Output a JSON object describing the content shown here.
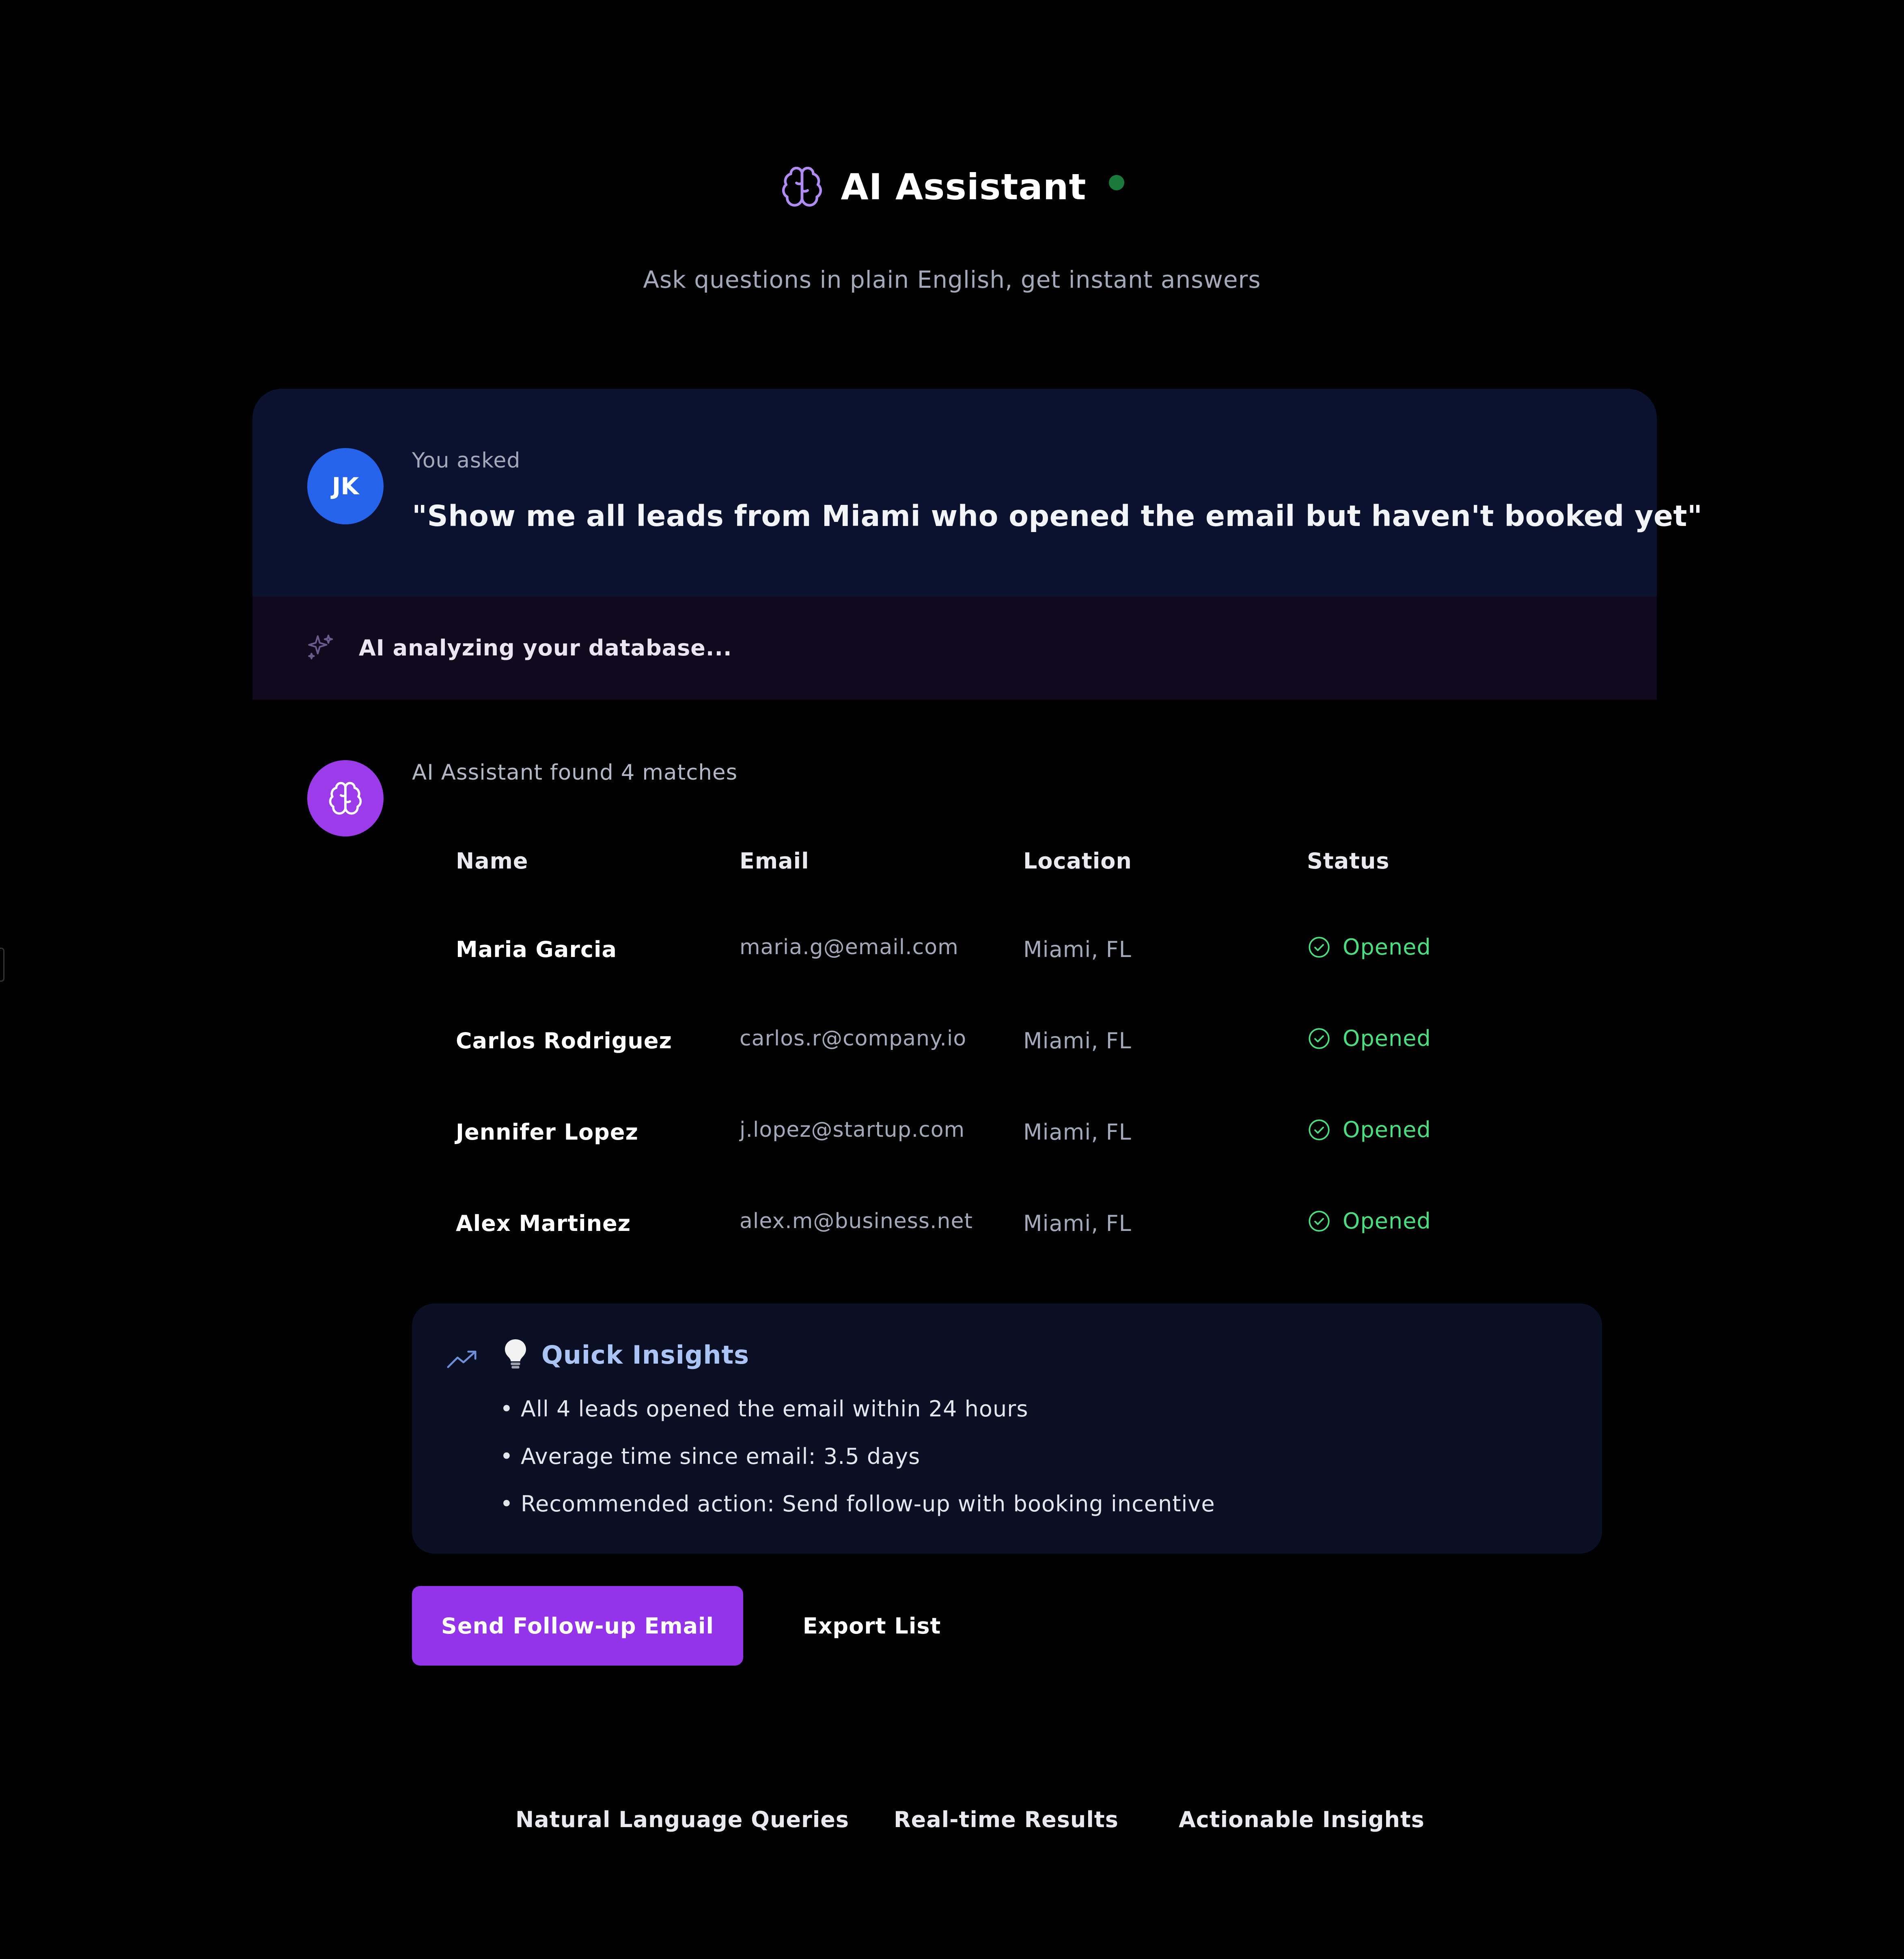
{
  "header": {
    "title": "AI Assistant",
    "subtitle": "Ask questions in plain English, get instant answers",
    "status_color": "#1a7a3c",
    "icon": "brain-icon"
  },
  "query": {
    "avatar_initials": "JK",
    "label": "You asked",
    "text": "\"Show me all leads from Miami who opened the email but haven't booked yet\""
  },
  "analyzing": {
    "icon": "sparkle-icon",
    "text": "AI analyzing your database..."
  },
  "results": {
    "avatar_icon": "brain-icon",
    "summary": "AI Assistant found 4 matches",
    "columns": [
      "Name",
      "Email",
      "Location",
      "Status"
    ],
    "rows": [
      {
        "name": "Maria Garcia",
        "email": "maria.g@email.com",
        "location": "Miami, FL",
        "status": "Opened"
      },
      {
        "name": "Carlos Rodriguez",
        "email": "carlos.r@company.io",
        "location": "Miami, FL",
        "status": "Opened"
      },
      {
        "name": "Jennifer Lopez",
        "email": "j.lopez@startup.com",
        "location": "Miami, FL",
        "status": "Opened"
      },
      {
        "name": "Alex Martinez",
        "email": "alex.m@business.net",
        "location": "Miami, FL",
        "status": "Opened"
      }
    ],
    "status_color": "#4ade80"
  },
  "insights": {
    "title": "Quick Insights",
    "items": [
      "• All 4 leads opened the email within 24 hours",
      "• Average time since email: 3.5 days",
      "• Recommended action: Send follow-up with booking incentive"
    ]
  },
  "actions": {
    "primary": "Send Follow-up Email",
    "secondary": "Export List",
    "primary_color": "#9333ea"
  },
  "features": [
    "Natural Language Queries",
    "Real-time Results",
    "Actionable Insights"
  ]
}
